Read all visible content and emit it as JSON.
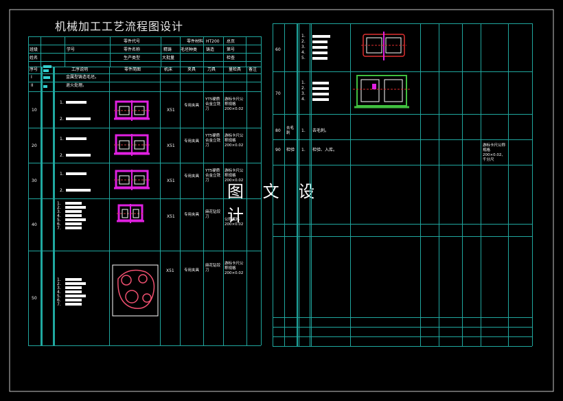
{
  "title": "机械加工工艺流程图设计",
  "watermark": "图 文 设 计",
  "header": {
    "part_code": "零件代号",
    "material_label": "零件材料",
    "material_value": "HT200",
    "sheet_total": "总页",
    "class_label": "班级",
    "student_no": "学号",
    "part_name": "零件名称",
    "blank_label": "精铸",
    "blank_type": "毛坯种类",
    "cast": "铸造",
    "sheet_no": "第号",
    "name_label": "姓名",
    "prod_type": "生产类型",
    "batch": "大批量",
    "checker": "检查"
  },
  "columns": [
    "序号",
    "工序说明",
    "零件简图",
    "机床",
    "夹具",
    "刀具",
    "量检具",
    "备注"
  ],
  "rows": [
    {
      "no": "I",
      "desc": "金属型铸造毛坯。"
    },
    {
      "no": "II",
      "desc": "退火处理。"
    },
    {
      "no": "10",
      "items": [
        "1.",
        "2."
      ],
      "machine": "X51",
      "fixture": "专用夹具",
      "tool": "YT5硬质合金立铣刀",
      "gauge": "游标卡尺公称规格200×0.02"
    },
    {
      "no": "20",
      "items": [
        "1.",
        "2."
      ],
      "machine": "X51",
      "fixture": "专用夹具",
      "tool": "YT5硬质合金立铣刀",
      "gauge": "游标卡尺公称规格200×0.02"
    },
    {
      "no": "30",
      "items": [
        "1.",
        "2."
      ],
      "machine": "X51",
      "fixture": "专用夹具",
      "tool": "YT5硬质合金立铣刀",
      "gauge": "游标卡尺公称规格200×0.02"
    },
    {
      "no": "40",
      "items": [
        "1.",
        "2.",
        "3.",
        "4.",
        "5.",
        "6.",
        "7."
      ],
      "machine": "X51",
      "fixture": "专用夹具",
      "tool": "麻花钻铰刀",
      "gauge": "公称规格200×0.02"
    },
    {
      "no": "50",
      "items": [
        "1.",
        "2.",
        "3.",
        "4.",
        "5.",
        "6.",
        "7."
      ],
      "machine": "X51",
      "fixture": "专用夹具",
      "tool": "麻花钻铰刀",
      "gauge": "游标卡尺公称规格200×0.02"
    }
  ],
  "right_rows": [
    {
      "no": "60",
      "items": [
        "1.",
        "2.",
        "3.",
        "4.",
        "5."
      ]
    },
    {
      "no": "70",
      "items": [
        "1.",
        "2.",
        "3.",
        "4."
      ]
    },
    {
      "no": "80",
      "op": "去毛刺",
      "step": "1.",
      "desc": "去毛刺。"
    },
    {
      "no": "90",
      "op": "检验",
      "step": "1.",
      "desc": "检验、入库。",
      "gauge": "游标卡尺公称规格200×0.02、千分尺"
    }
  ]
}
